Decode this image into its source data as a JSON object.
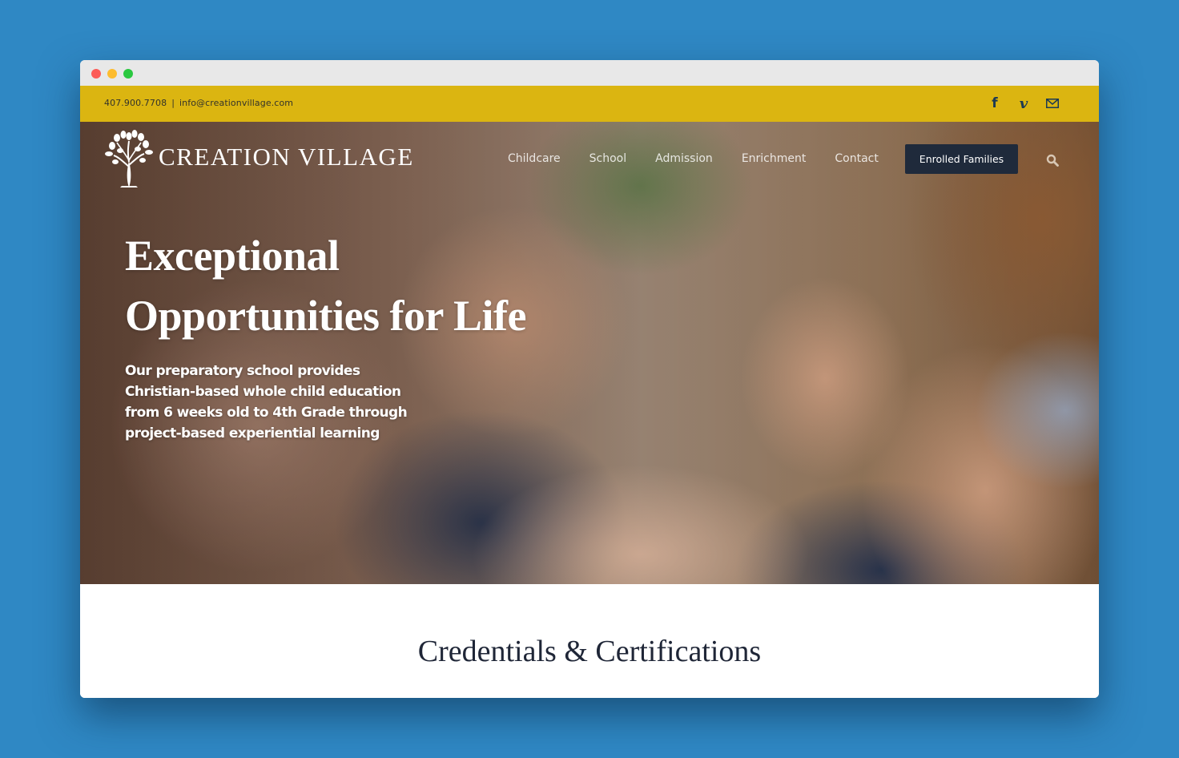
{
  "window": {
    "controls": [
      "close",
      "minimize",
      "maximize"
    ]
  },
  "topbar": {
    "phone": "407.900.7708",
    "separator": "|",
    "email": "info@creationvillage.com",
    "social": [
      {
        "name": "facebook-icon",
        "glyph": "f"
      },
      {
        "name": "vimeo-icon",
        "glyph": "v"
      },
      {
        "name": "mail-icon",
        "glyph": "envelope"
      }
    ],
    "color": "#dbb511"
  },
  "header": {
    "logo_text": "CREATION VILLAGE",
    "nav": [
      {
        "label": "Childcare"
      },
      {
        "label": "School"
      },
      {
        "label": "Admission"
      },
      {
        "label": "Enrichment"
      },
      {
        "label": "Contact"
      }
    ],
    "cta_label": "Enrolled Families",
    "search_icon": "search-icon"
  },
  "hero": {
    "title_line1": "Exceptional",
    "title_line2": "Opportunities for Life",
    "subtitle": "Our preparatory school provides Christian-based whole child education from 6 weeks old to 4th Grade through project-based experiential learning"
  },
  "content": {
    "section_title": "Credentials & Certifications"
  }
}
